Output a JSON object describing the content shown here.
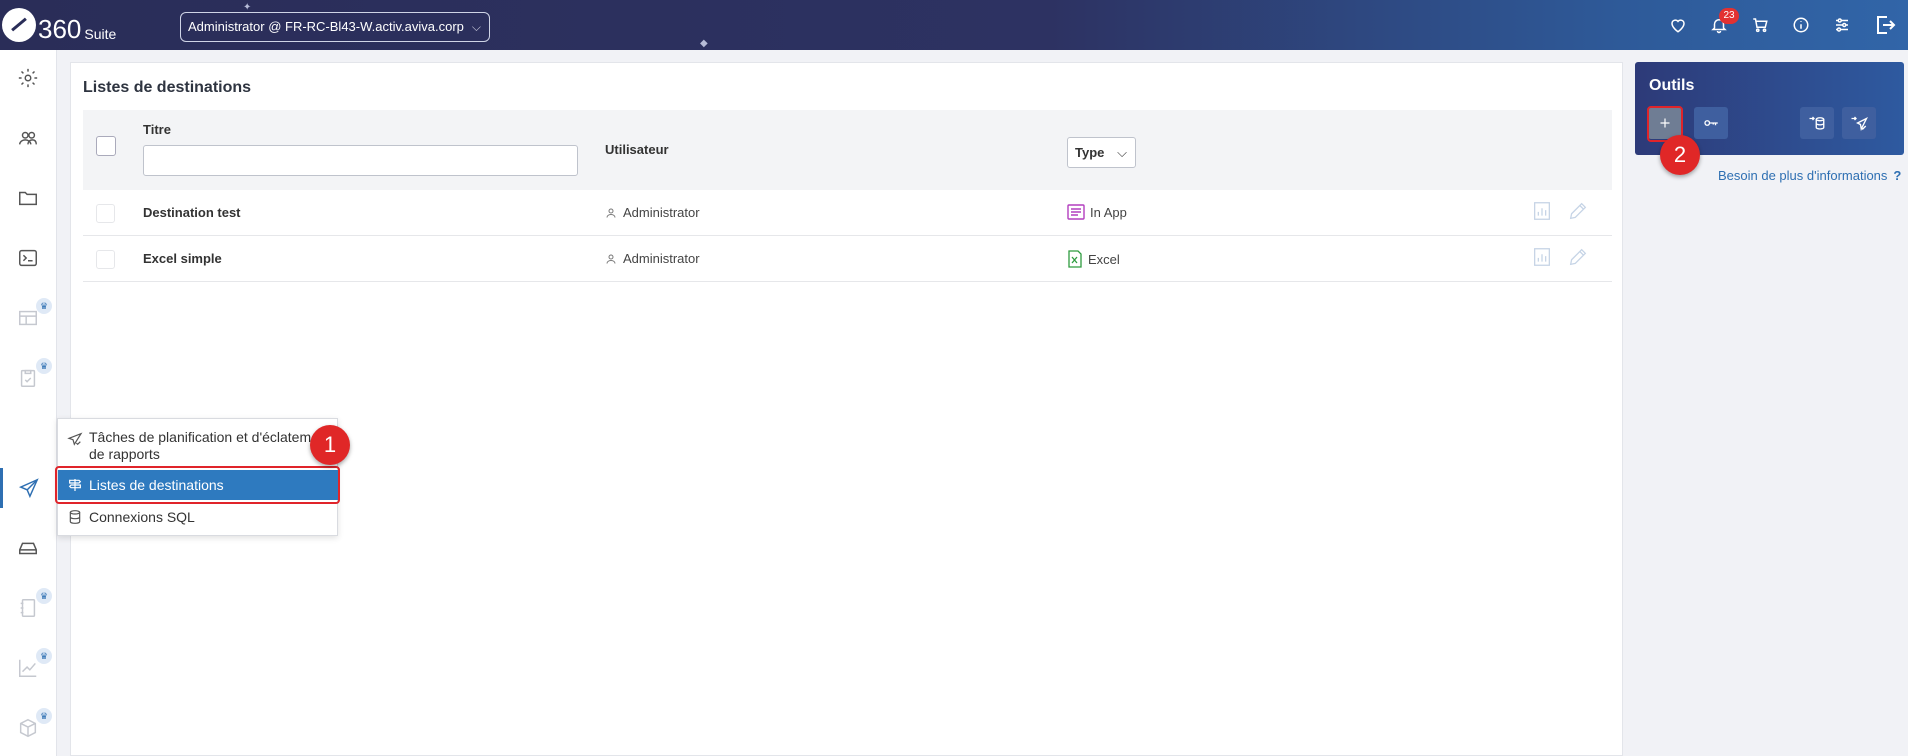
{
  "header": {
    "logo_number": "360",
    "logo_suite": "Suite",
    "server": "Administrator @ FR-RC-Bl43-W.activ.aviva.corp",
    "notifications_count": "23",
    "icons": [
      "heart-icon",
      "bell-icon",
      "cart-icon",
      "info-icon",
      "sliders-icon",
      "logout-icon"
    ]
  },
  "sidebar": {
    "items": [
      "gear-icon",
      "users-icon",
      "folder-icon",
      "terminal-icon",
      "layout-icon",
      "clipboard-icon",
      "send-icon",
      "drive-icon",
      "notebook-icon",
      "chart-icon",
      "cube-icon"
    ],
    "premium_marks": [
      "layout-icon",
      "clipboard-icon",
      "notebook-icon",
      "chart-icon",
      "cube-icon"
    ],
    "active": "send-icon"
  },
  "main": {
    "title": "Listes de destinations",
    "columns": {
      "title": "Titre",
      "user": "Utilisateur",
      "type": "Type"
    },
    "title_filter_value": "",
    "rows": [
      {
        "name": "Destination test",
        "user": "Administrator",
        "type": "In App",
        "type_icon": "inapp-icon"
      },
      {
        "name": "Excel simple",
        "user": "Administrator",
        "type": "Excel",
        "type_icon": "excel-icon"
      }
    ]
  },
  "flyout": {
    "items": [
      {
        "label": "Tâches de planification et d'éclatement de rapports",
        "icon": "send-check-icon"
      },
      {
        "label": "Listes de destinations",
        "icon": "signpost-icon",
        "selected": true
      },
      {
        "label": "Connexions SQL",
        "icon": "database-icon"
      }
    ]
  },
  "tools": {
    "title": "Outils",
    "buttons": [
      "plus-icon",
      "key-icon",
      "import-database-icon",
      "import-send-icon"
    ],
    "help_text": "Besoin de plus d'informations",
    "help_mark": "?"
  },
  "annotations": {
    "step1": "1",
    "step2": "2",
    "color": "#e02727"
  }
}
